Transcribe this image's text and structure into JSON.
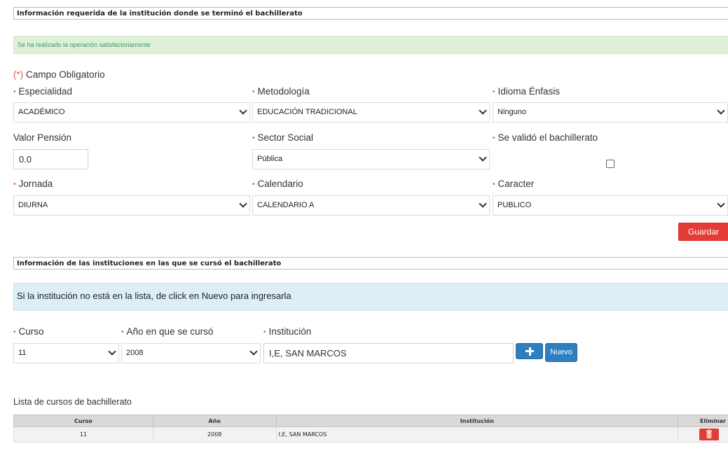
{
  "section1": {
    "header": "Información requerida de la institución donde se terminó el bachillerato",
    "success_message": "Se ha realizado la operación satisfactoriamente",
    "required_note_paren": "(*)",
    "required_note_text": "Campo Obligatorio",
    "required_marker": "•",
    "labels": {
      "especialidad": "Especialidad",
      "metodologia": "Metodología",
      "idioma": "Idioma Énfasis",
      "valor_pension": "Valor Pensión",
      "sector_social": "Sector Social",
      "validado": "Se validó el bachillerato",
      "jornada": "Jornada",
      "calendario": "Calendario",
      "caracter": "Caracter"
    },
    "values": {
      "especialidad": "ACADÉMICO",
      "metodologia": "EDUCACIÓN TRADICIONAL",
      "idioma": "Ninguno",
      "valor_pension": "0.0",
      "sector_social": "Pública",
      "validado": false,
      "jornada": "DIURNA",
      "calendario": "CALENDARIO A",
      "caracter": "PUBLICO"
    },
    "save_label": "Guardar"
  },
  "section2": {
    "header": "Información de las instituciones en las que se cursó el bachillerato",
    "info_message": "Si la institución no está en la lista, de click en Nuevo para ingresarla",
    "labels": {
      "curso": "Curso",
      "anio": "Año en que se cursó",
      "institucion": "Institución"
    },
    "values": {
      "curso": "11",
      "anio": "2008",
      "institucion": "I,E, SAN MARCOS"
    },
    "add_icon": "plus-icon",
    "new_label": "Nuevo"
  },
  "table": {
    "title": "Lista de cursos de bachillerato",
    "columns": [
      "Curso",
      "Año",
      "Institución",
      "Eliminar"
    ],
    "rows": [
      {
        "curso": "11",
        "anio": "2008",
        "institucion": "I,E, SAN MARCOS",
        "delete_icon": "trash-icon"
      }
    ]
  },
  "colors": {
    "danger": "#e53b36",
    "primary": "#2f7fc0",
    "success_bg": "#dff0d8",
    "info_bg": "#ddeef6",
    "required": "#e0553e"
  }
}
